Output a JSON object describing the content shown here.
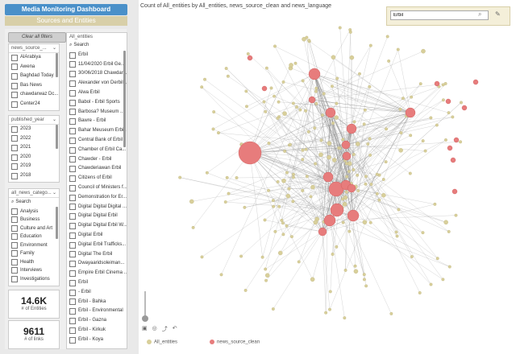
{
  "dashboard": {
    "title": "Media Monitoring Dashboard",
    "subtitle": "Sources and Entities"
  },
  "clear_filters_label": "Clear all filters",
  "news_source": {
    "header": "news_source_...",
    "items": [
      "AlArabiya",
      "Awena",
      "Baghdad Today",
      "Bas News",
      "chawdarwaz Dc...",
      "Center24"
    ]
  },
  "published_year": {
    "header": "published_year",
    "items": [
      "2023",
      "2022",
      "2021",
      "2020",
      "2019",
      "2018"
    ]
  },
  "news_category": {
    "header": "all_news_catego...",
    "search": "Search",
    "items": [
      "Analysis",
      "Business",
      "Culture and Art",
      "Education",
      "Environment",
      "Family",
      "Health",
      "Interviews",
      "Investigations"
    ]
  },
  "kpis": [
    {
      "value": "14.6K",
      "label": "# of Entities"
    },
    {
      "value": "9611",
      "label": "# of links"
    }
  ],
  "entities": {
    "header": "All_entities",
    "search": "Search",
    "items": [
      "Erbil",
      "11/04/2020 Erbil Ge...",
      "30/06/2018 Chawdar...",
      "Alexander von Derbilli...",
      "Alwa Erbil",
      "Babol - Erbil Sports",
      "Barbosa? Museum ...",
      "Bawre - Erbil",
      "Bahar Meuseum Erbi...",
      "Central Bank of Erbil",
      "Chamber of Erbil Ca...",
      "Chawder - Erbil",
      "Chawderiawan Erbil",
      "Citizens of Erbil",
      "Council of Ministers f...",
      "Demonstration for Er...",
      "Digital Digital Digital ...",
      "Digital Digital Erbil",
      "Digital Digital Erbil W...",
      "Digital Erbil",
      "Digital Erbil Trafficks...",
      "Digital The Erbil",
      "Dwayaaridsoleiman...",
      "Empire Erbil Cinema ...",
      "Erbil",
      "- Erbil",
      "Erbil - Bahka",
      "Erbil - Environmental",
      "Erbil - Gazna",
      "Erbil - Kirkuk",
      "Erbil - Koya"
    ]
  },
  "chart": {
    "title": "Count of All_entities by All_entities, news_source_clean and news_language"
  },
  "search": {
    "value": "Erbil"
  },
  "legend": [
    {
      "label": "All_entities",
      "color": "#d8cf9a"
    },
    {
      "label": "news_source_clean",
      "color": "#e77c7c"
    }
  ],
  "toolbar_icons": [
    "image-icon",
    "zoom-fit-icon",
    "share-icon",
    "undo-icon"
  ]
}
